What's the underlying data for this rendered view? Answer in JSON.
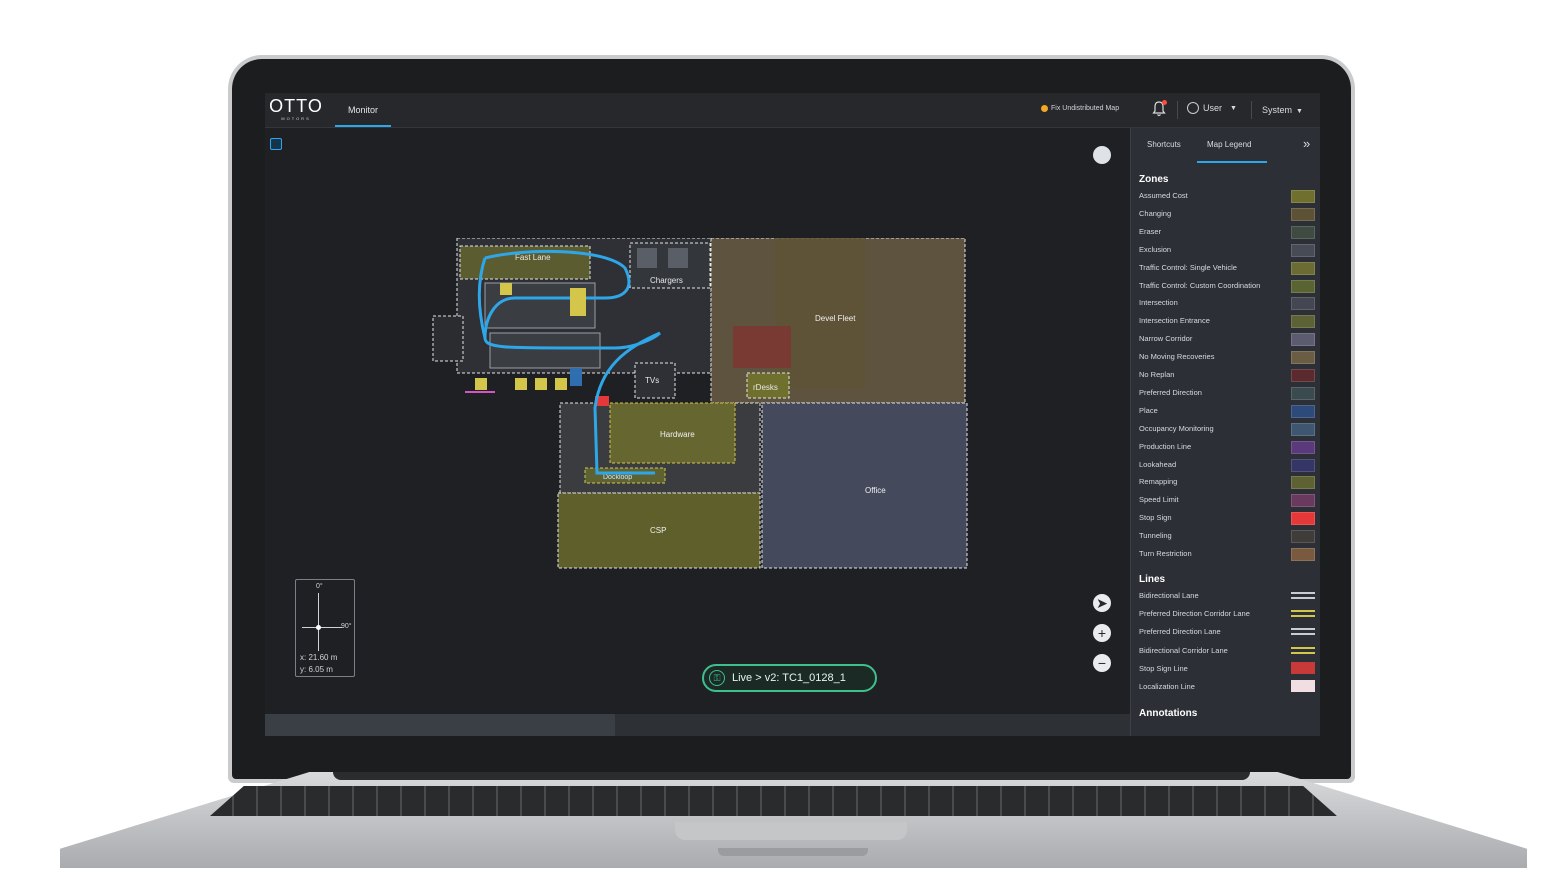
{
  "app": {
    "logo": "OTTO",
    "logo_sub": "MOTORS",
    "tab": "Monitor",
    "alert": "Fix Undistributed Map",
    "user": "User",
    "system": "System"
  },
  "map": {
    "zones": [
      "Chargers",
      "Devel Fleet",
      "TVs",
      "rDesks",
      "Hardware",
      "Office",
      "Dockloop",
      "CSP",
      "Fast Lane"
    ],
    "compass": {
      "top": "0°",
      "right": "90°",
      "x": "x: 21.60 m",
      "y": "y: 6.05 m"
    },
    "version": "Live > v2: TC1_0128_1"
  },
  "panel": {
    "tabs": [
      "Shortcuts",
      "Map Legend"
    ],
    "zones_title": "Zones",
    "zones": [
      {
        "label": "Assumed Cost",
        "color": "#6f6f2e"
      },
      {
        "label": "Changing",
        "color": "#5e5236"
      },
      {
        "label": "Eraser",
        "color": "#3f4a40"
      },
      {
        "label": "Exclusion",
        "color": "#474b55"
      },
      {
        "label": "Traffic Control: Single Vehicle",
        "color": "#6b6c33"
      },
      {
        "label": "Traffic Control: Custom Coordination",
        "color": "#5a6433"
      },
      {
        "label": "Intersection",
        "color": "#444751"
      },
      {
        "label": "Intersection Entrance",
        "color": "#5d6236"
      },
      {
        "label": "Narrow Corridor",
        "color": "#5d5b70"
      },
      {
        "label": "No Moving Recoveries",
        "color": "#6a5d43"
      },
      {
        "label": "No Replan",
        "color": "#5a2a2e"
      },
      {
        "label": "Preferred Direction",
        "color": "#3a4a4e"
      },
      {
        "label": "Place",
        "color": "#2d4a7a"
      },
      {
        "label": "Occupancy Monitoring",
        "color": "#3f5670"
      },
      {
        "label": "Production Line",
        "color": "#5a3a7a"
      },
      {
        "label": "Lookahead",
        "color": "#353566"
      },
      {
        "label": "Remapping",
        "color": "#5e6233"
      },
      {
        "label": "Speed Limit",
        "color": "#6a3a5e"
      },
      {
        "label": "Stop Sign",
        "color": "#e63838"
      },
      {
        "label": "Tunneling",
        "color": "#3f3c3a"
      },
      {
        "label": "Turn Restriction",
        "color": "#7a5a3e"
      }
    ],
    "lines_title": "Lines",
    "lines": [
      {
        "label": "Bidirectional Lane",
        "color": "#c9ccd1"
      },
      {
        "label": "Preferred Direction Corridor Lane",
        "color": "#d4c64a"
      },
      {
        "label": "Preferred Direction Lane",
        "color": "#c9ccd1"
      },
      {
        "label": "Bidirectional Corridor Lane",
        "color": "#d4c64a"
      },
      {
        "label": "Stop Sign Line",
        "color": "#c83a3a"
      },
      {
        "label": "Localization Line",
        "color": "#f2dde2"
      }
    ],
    "annotations_title": "Annotations"
  }
}
